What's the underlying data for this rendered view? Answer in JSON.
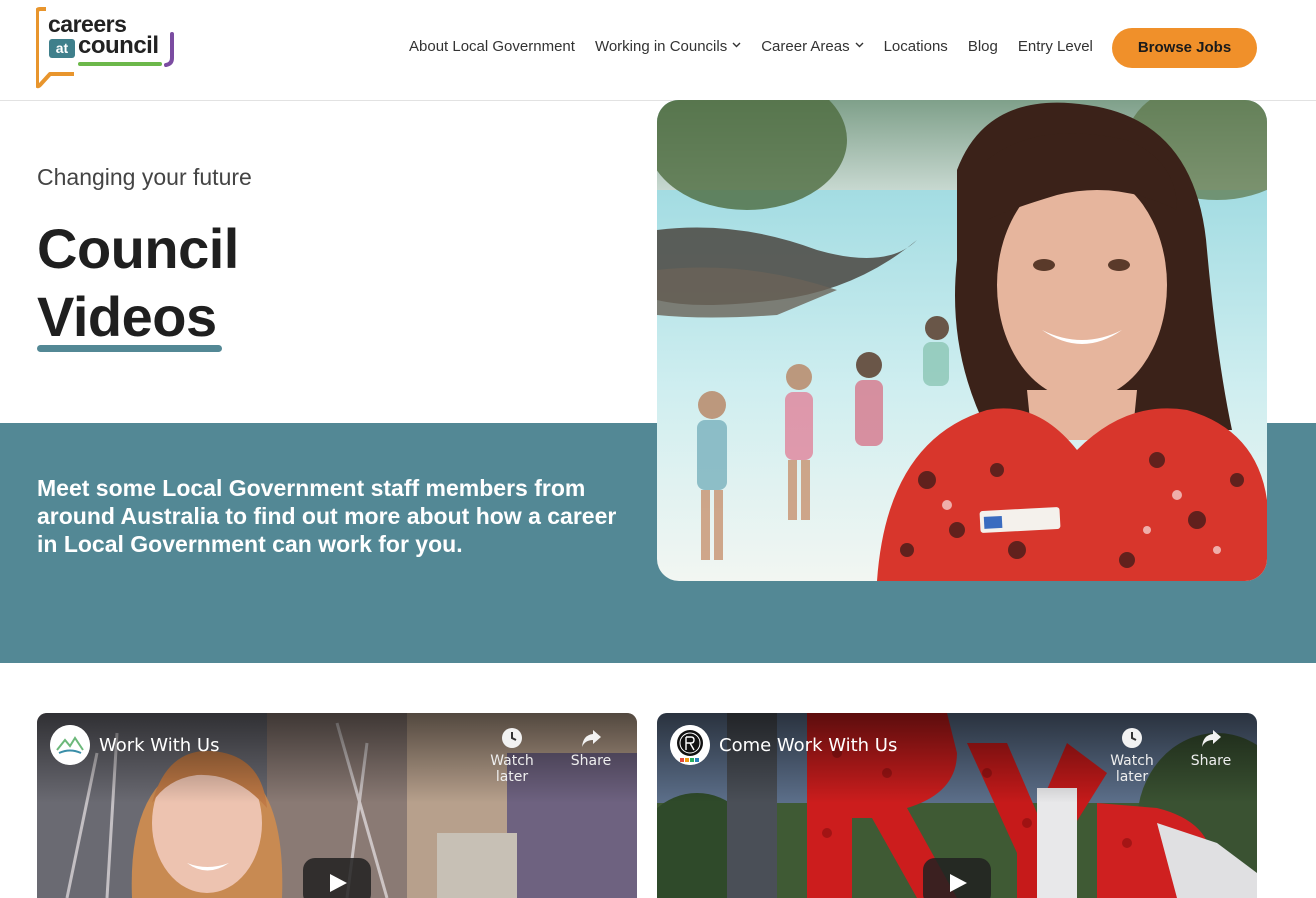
{
  "brand": {
    "line1": "careers",
    "line2": "at",
    "line3": "council"
  },
  "nav": {
    "items": [
      {
        "label": "About Local Government",
        "has_dropdown": false
      },
      {
        "label": "Working in Councils",
        "has_dropdown": true
      },
      {
        "label": "Career Areas",
        "has_dropdown": true
      },
      {
        "label": "Locations",
        "has_dropdown": false
      },
      {
        "label": "Blog",
        "has_dropdown": false
      },
      {
        "label": "Entry Level",
        "has_dropdown": false
      }
    ],
    "cta_label": "Browse Jobs"
  },
  "hero": {
    "eyebrow": "Changing your future",
    "title_line1": "Council",
    "title_line2": "Videos",
    "intro": "Meet some Local Government staff members from around Australia to find out more about how a career in Local Government can work for you."
  },
  "videos": [
    {
      "title": "Work With Us",
      "watch_later": "Watch later",
      "share": "Share"
    },
    {
      "title": "Come Work With Us",
      "watch_later": "Watch later",
      "share": "Share"
    }
  ],
  "colors": {
    "teal": "#538895",
    "orange": "#f0902a",
    "logo_orange": "#e8952d",
    "logo_green": "#6cb84a",
    "logo_purple": "#7b4ca1"
  }
}
